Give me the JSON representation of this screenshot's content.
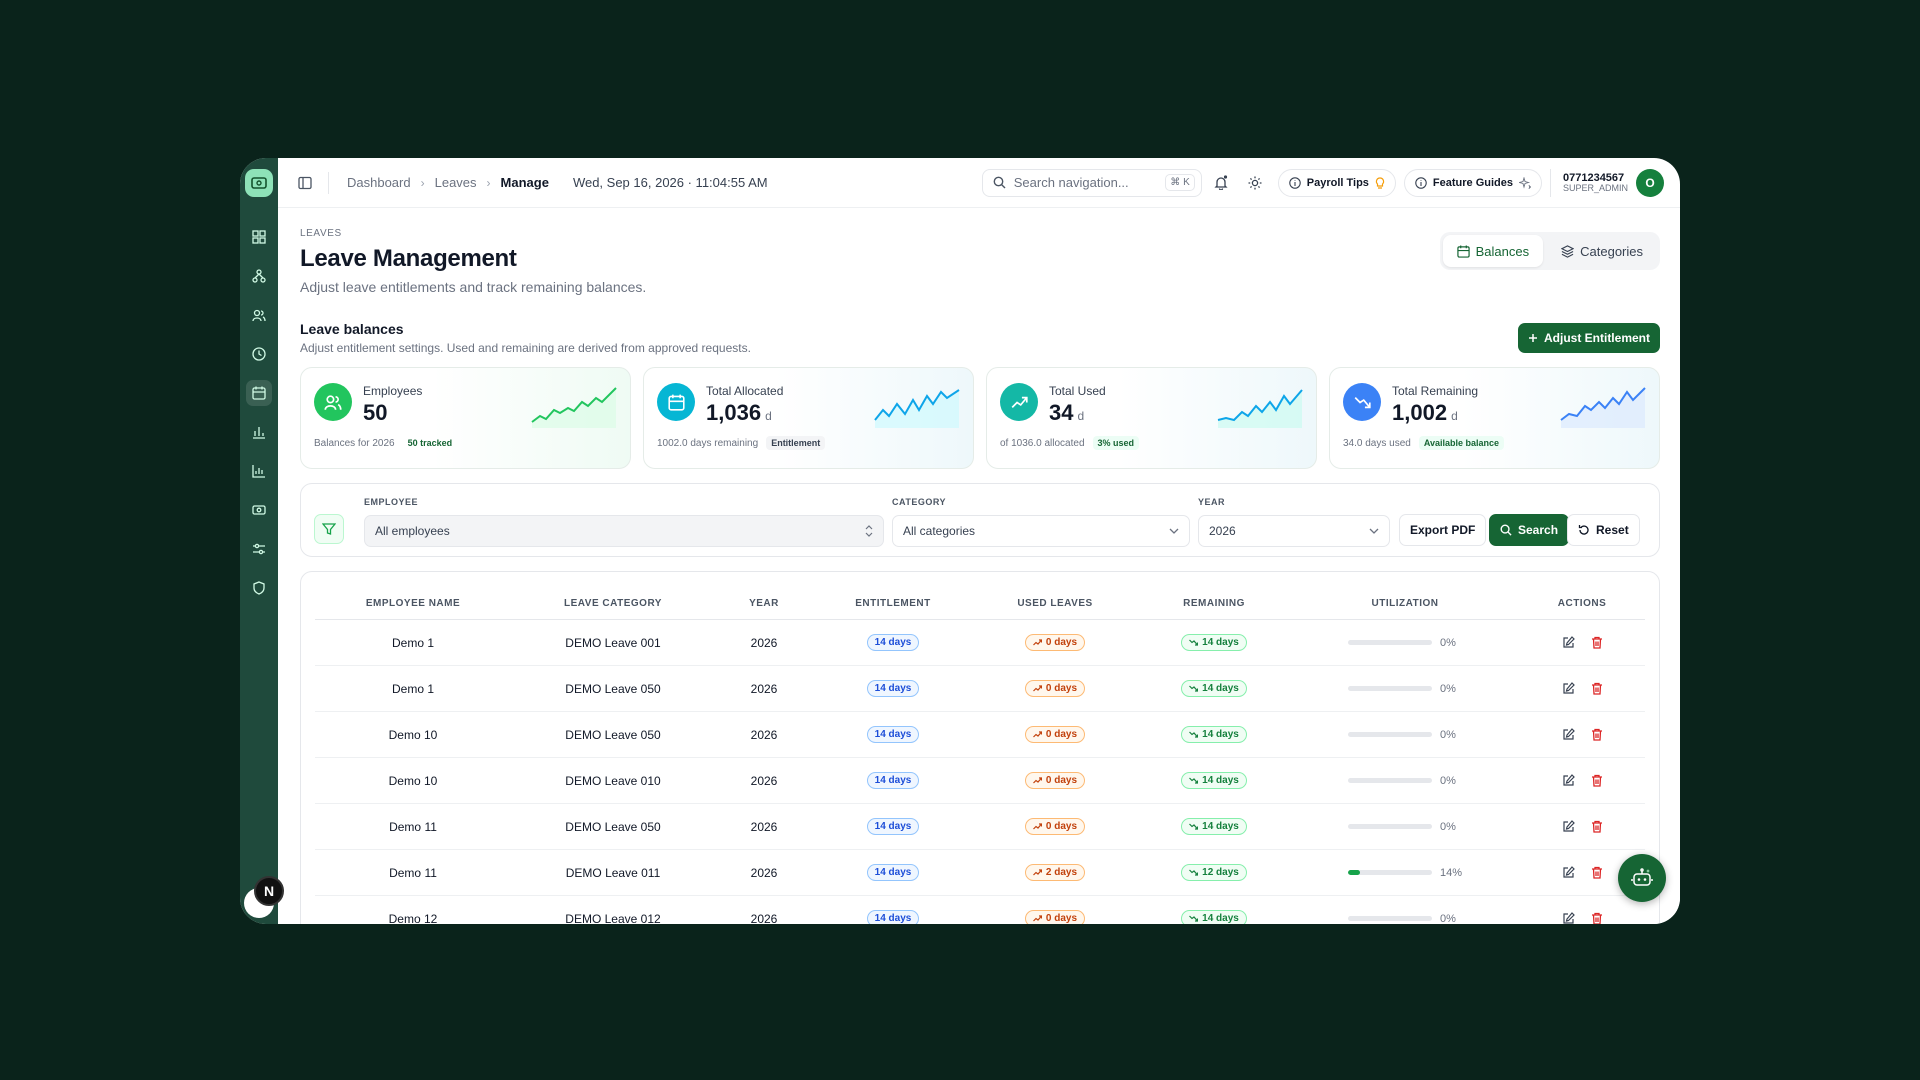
{
  "topbar": {
    "breadcrumb": [
      "Dashboard",
      "Leaves",
      "Manage"
    ],
    "datetime": "Wed, Sep 16, 2026 · 11:04:55 AM",
    "search_placeholder": "Search navigation...",
    "search_shortcut": "⌘ K",
    "payroll_tips": "Payroll Tips",
    "feature_guides": "Feature Guides",
    "user_phone": "0771234567",
    "user_role": "SUPER_ADMIN",
    "user_initial": "O"
  },
  "page": {
    "kicker": "LEAVES",
    "title": "Leave Management",
    "subtitle": "Adjust leave entitlements and track remaining balances.",
    "tabs": [
      "Balances",
      "Categories"
    ],
    "active_tab": "Balances",
    "section_title": "Leave balances",
    "section_subtitle": "Adjust entitlement settings. Used and remaining are derived from approved requests.",
    "adjust_button": "Adjust Entitlement"
  },
  "stats": [
    {
      "label": "Employees",
      "value": "50",
      "unit": "",
      "foot": "Balances for 2026",
      "tag": "50 tracked",
      "color": "#22c55e",
      "tag_color": "#166534",
      "tag_bg": "transparent"
    },
    {
      "label": "Total Allocated",
      "value": "1,036",
      "unit": "d",
      "foot": "1002.0 days remaining",
      "tag": "Entitlement",
      "color": "#06b6d4",
      "tag_color": "#374151",
      "tag_bg": "#f3f4f6"
    },
    {
      "label": "Total Used",
      "value": "34",
      "unit": "d",
      "foot": "of 1036.0 allocated",
      "tag": "3% used",
      "color": "#14b8a6",
      "tag_color": "#166534",
      "tag_bg": "#ecfdf5"
    },
    {
      "label": "Total Remaining",
      "value": "1,002",
      "unit": "d",
      "foot": "34.0 days used",
      "tag": "Available balance",
      "color": "#3b82f6",
      "tag_color": "#166534",
      "tag_bg": "#ecfdf5"
    }
  ],
  "filters": {
    "employee_label": "EMPLOYEE",
    "employee_value": "All employees",
    "category_label": "CATEGORY",
    "category_value": "All categories",
    "year_label": "YEAR",
    "year_value": "2026",
    "export_label": "Export PDF",
    "search_label": "Search",
    "reset_label": "Reset"
  },
  "table": {
    "headers": [
      "EMPLOYEE NAME",
      "LEAVE CATEGORY",
      "YEAR",
      "ENTITLEMENT",
      "USED LEAVES",
      "REMAINING",
      "UTILIZATION",
      "ACTIONS"
    ],
    "rows": [
      {
        "name": "Demo 1",
        "category": "DEMO Leave 001",
        "year": "2026",
        "entitlement": "14 days",
        "used": "0 days",
        "remaining": "14 days",
        "util": "0%",
        "util_frac": 0
      },
      {
        "name": "Demo 1",
        "category": "DEMO Leave 050",
        "year": "2026",
        "entitlement": "14 days",
        "used": "0 days",
        "remaining": "14 days",
        "util": "0%",
        "util_frac": 0
      },
      {
        "name": "Demo 10",
        "category": "DEMO Leave 050",
        "year": "2026",
        "entitlement": "14 days",
        "used": "0 days",
        "remaining": "14 days",
        "util": "0%",
        "util_frac": 0
      },
      {
        "name": "Demo 10",
        "category": "DEMO Leave 010",
        "year": "2026",
        "entitlement": "14 days",
        "used": "0 days",
        "remaining": "14 days",
        "util": "0%",
        "util_frac": 0
      },
      {
        "name": "Demo 11",
        "category": "DEMO Leave 050",
        "year": "2026",
        "entitlement": "14 days",
        "used": "0 days",
        "remaining": "14 days",
        "util": "0%",
        "util_frac": 0
      },
      {
        "name": "Demo 11",
        "category": "DEMO Leave 011",
        "year": "2026",
        "entitlement": "14 days",
        "used": "2 days",
        "remaining": "12 days",
        "util": "14%",
        "util_frac": 0.14
      },
      {
        "name": "Demo 12",
        "category": "DEMO Leave 012",
        "year": "2026",
        "entitlement": "14 days",
        "used": "0 days",
        "remaining": "14 days",
        "util": "0%",
        "util_frac": 0
      }
    ]
  },
  "colors": {
    "brand": "#166534",
    "accent": "#16a34a",
    "danger": "#dc2626"
  },
  "icons": [
    "sidebar-toggle-icon",
    "search-icon",
    "bell-icon",
    "sun-icon",
    "lightbulb-icon",
    "sparkle-icon",
    "calendar-icon",
    "layers-icon",
    "plus-icon",
    "users-icon",
    "trend-up-icon",
    "trend-down-icon",
    "filter-icon",
    "refresh-icon",
    "edit-icon",
    "trash-icon",
    "bot-icon"
  ],
  "floating": {
    "n_badge": "N"
  }
}
